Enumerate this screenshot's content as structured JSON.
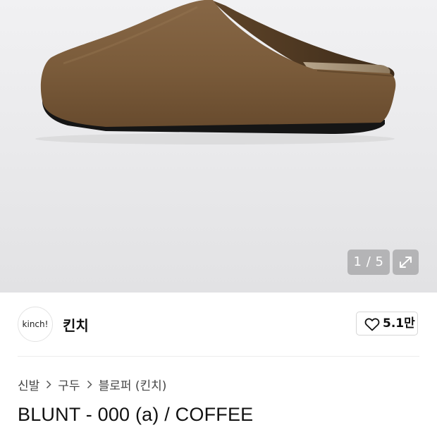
{
  "gallery": {
    "image": "brown-suede-mule-icon",
    "counter": "1 / 5",
    "current_index": 1,
    "total": 5
  },
  "brand": {
    "logo_text": "kinch!",
    "name": "킨치"
  },
  "like": {
    "count": "5.1만"
  },
  "breadcrumb": {
    "items": [
      "신발",
      "구두",
      "블로퍼 (킨치)"
    ]
  },
  "product": {
    "title": "BLUNT - 000 (a) / COFFEE"
  },
  "colors": {
    "suede": "#7a5b3a",
    "sole": "#141414",
    "badge_bg": "#969698"
  }
}
